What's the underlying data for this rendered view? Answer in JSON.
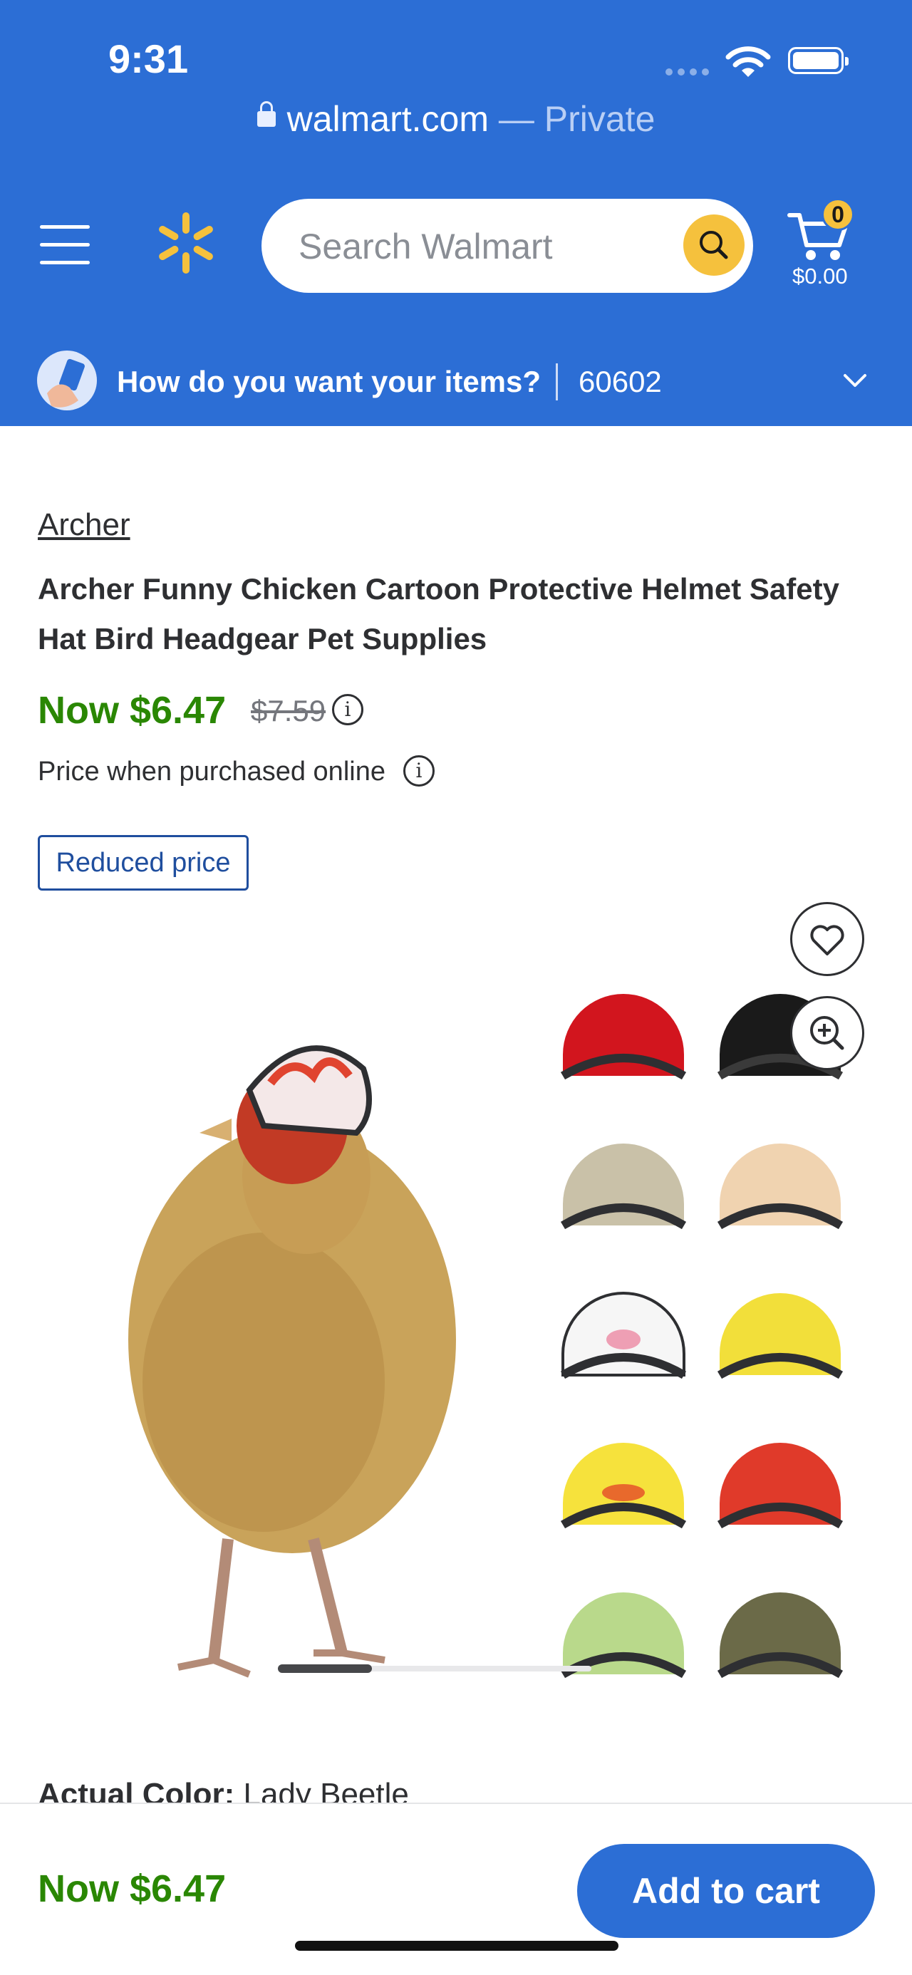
{
  "status_bar": {
    "time": "9:31"
  },
  "browser": {
    "domain": "walmart.com",
    "mode": "— Private"
  },
  "header": {
    "search_placeholder": "Search Walmart",
    "cart_count": "0",
    "cart_total": "$0.00",
    "accent_color": "#2c6ed5",
    "spark_color": "#f5c13d"
  },
  "delivery": {
    "prompt": "How do you want your items?",
    "zip": "60602"
  },
  "product": {
    "brand": "Archer",
    "title": "Archer Funny Chicken Cartoon Protective Helmet Safety Hat Bird Headgear Pet Supplies",
    "price_now": "Now $6.47",
    "price_was": "$7.59",
    "price_note": "Price when purchased online",
    "badge": "Reduced price",
    "info_glyph": "i",
    "color_label": "Actual Color:",
    "color_value": "Lady Beetle"
  },
  "bottom_bar": {
    "price": "Now $6.47",
    "add_to_cart": "Add to cart"
  }
}
